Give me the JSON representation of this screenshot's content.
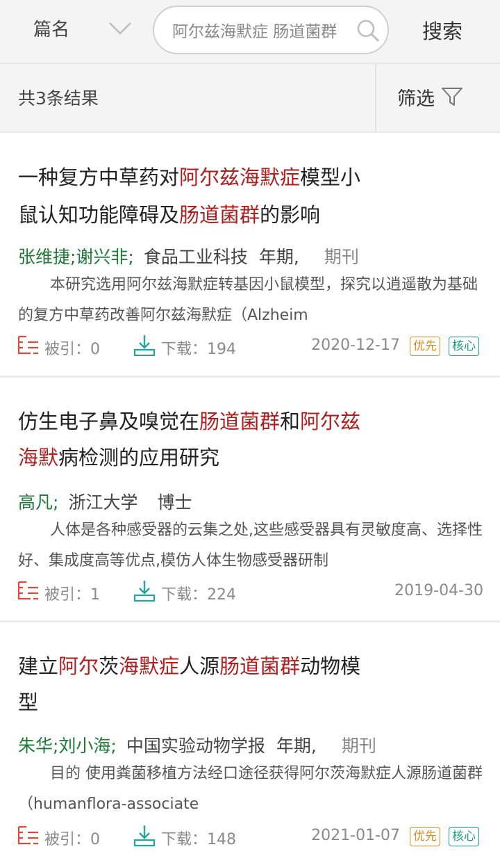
{
  "search": {
    "field": "篇名",
    "query": "阿尔兹海默症 肠道菌群",
    "button": "搜索"
  },
  "results": {
    "count_label": "共3条结果",
    "filter_label": "筛选"
  },
  "labels": {
    "cite": "被引：",
    "download": "下载："
  },
  "colors": {
    "highlight": "#b01d1d",
    "authors": "#1f7a3a",
    "badge_priority": "#e08a1e",
    "badge_core": "#1b9b83"
  },
  "articles": [
    {
      "title_line1": [
        {
          "text": "一种复方中草药对",
          "hl": false
        },
        {
          "text": "阿尔兹海默症",
          "hl": true
        },
        {
          "text": "模型小",
          "hl": false
        }
      ],
      "title_line2": [
        {
          "text": "鼠认知功能障碍及",
          "hl": false
        },
        {
          "text": "肠道菌群",
          "hl": true
        },
        {
          "text": "的影响",
          "hl": false
        }
      ],
      "authors": "张维捷;谢兴非;",
      "source": "食品工业科技",
      "year": "年期,",
      "type": "期刊",
      "abstract": "本研究选用阿尔兹海默症转基因小鼠模型，探究以逍遥散为基础的复方中草药改善阿尔兹海默症（Alzheim",
      "cite": "0",
      "download": "194",
      "date": "2020-12-17",
      "badges": [
        "优先",
        "核心"
      ]
    },
    {
      "title_line1": [
        {
          "text": "仿生电子鼻及嗅觉在",
          "hl": false
        },
        {
          "text": "肠道菌群",
          "hl": true
        },
        {
          "text": "和",
          "hl": false
        },
        {
          "text": "阿尔兹",
          "hl": true
        }
      ],
      "title_line2": [
        {
          "text": "海默",
          "hl": true
        },
        {
          "text": "病检测的应用研究",
          "hl": false
        }
      ],
      "authors": "高凡;",
      "source": "浙江大学",
      "year": "",
      "type": "博士",
      "abstract": "人体是各种感受器的云集之处,这些感受器具有灵敏度高、选择性好、集成度高等优点,模仿人体生物感受器研制",
      "cite": "1",
      "download": "224",
      "date": "2019-04-30",
      "badges": []
    },
    {
      "title_line1": [
        {
          "text": "建立",
          "hl": false
        },
        {
          "text": "阿尔",
          "hl": true
        },
        {
          "text": "茨",
          "hl": false
        },
        {
          "text": "海默症",
          "hl": true
        },
        {
          "text": "人源",
          "hl": false
        },
        {
          "text": "肠道菌群",
          "hl": true
        },
        {
          "text": "动物模",
          "hl": false
        }
      ],
      "title_line2": [
        {
          "text": "型",
          "hl": false
        }
      ],
      "authors": "朱华;刘小海;",
      "source": "中国实验动物学报",
      "year": "年期,",
      "type": "期刊",
      "abstract": "目的 使用粪菌移植方法经口途径获得阿尔茨海默症人源肠道菌群（humanflora-associate",
      "cite": "0",
      "download": "148",
      "date": "2021-01-07",
      "badges": [
        "优先",
        "核心"
      ]
    }
  ]
}
